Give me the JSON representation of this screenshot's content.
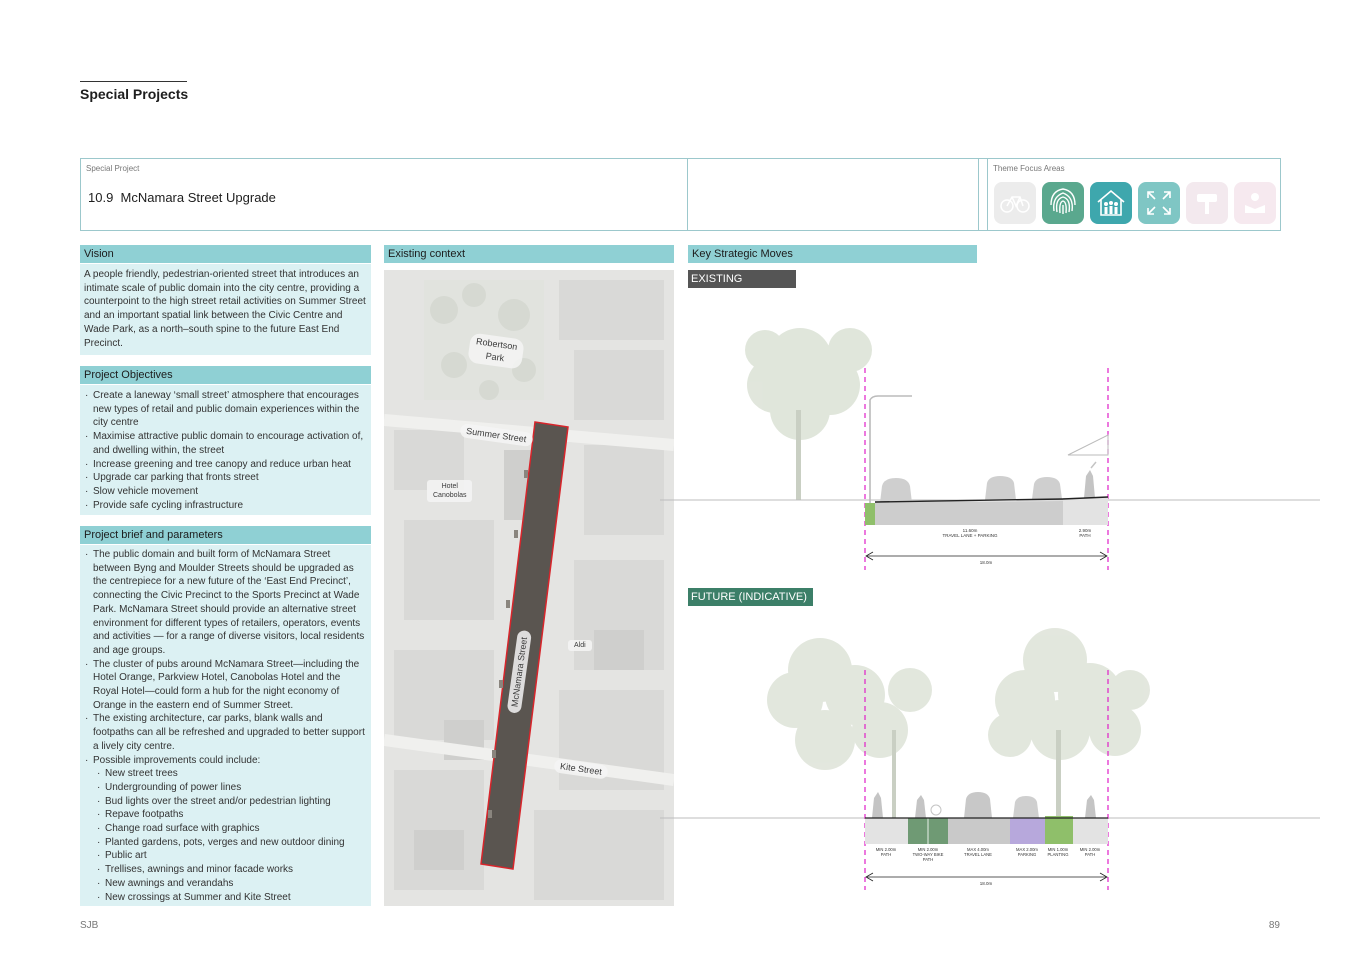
{
  "header": {
    "section_title": "Special Projects"
  },
  "project": {
    "label": "Special Project",
    "number": "10.9",
    "title": "McNamara Street Upgrade",
    "themes_label": "Theme Focus Areas",
    "theme_icons": [
      {
        "icon": "bicycle-icon",
        "active": false,
        "color": "#e6e6e6"
      },
      {
        "icon": "fingerprint-icon",
        "active": true,
        "color": "#5aa88e"
      },
      {
        "icon": "community-house-icon",
        "active": true,
        "color": "#3ea7ad"
      },
      {
        "icon": "expand-arrows-icon",
        "active": true,
        "color": "#7fc6c4"
      },
      {
        "icon": "heritage-icon",
        "active": false,
        "color": "#f3e9ee"
      },
      {
        "icon": "learning-icon",
        "active": false,
        "color": "#f6e9ef"
      }
    ]
  },
  "vision": {
    "heading": "Vision",
    "text": "A people friendly, pedestrian-oriented street that introduces an intimate scale of public domain into the city centre, providing a counterpoint to the high street retail activities on Summer Street and an important spatial link between the Civic Centre and Wade Park, as a north–south spine to the future East End Precinct."
  },
  "objectives": {
    "heading": "Project Objectives",
    "items": [
      "Create a laneway ‘small street’ atmosphere that encourages new types of retail and public domain experiences within the city centre",
      "Maximise attractive public domain to encourage activation of, and dwelling within, the street",
      "Increase greening and tree canopy and reduce urban heat",
      "Upgrade car parking that fronts street",
      "Slow vehicle movement",
      "Provide safe cycling infrastructure"
    ]
  },
  "brief": {
    "heading": "Project brief and parameters",
    "items": [
      "The public domain and built form of McNamara Street between Byng and Moulder Streets should be upgraded as the centrepiece for a new future of the ‘East End Precinct’, connecting the Civic Precinct to the Sports Precinct at Wade Park. McNamara Street should provide an alternative street environment for different types of retailers, operators, events and activities — for a range of diverse visitors, local residents and age groups.",
      "The cluster of pubs around McNamara Street—including the Hotel Orange, Parkview Hotel, Canobolas Hotel and the Royal Hotel—could form a hub for the night economy of Orange in the eastern end of Summer Street.",
      "The existing architecture, car parks, blank walls and footpaths can all be refreshed and upgraded to better support a lively city centre."
    ],
    "improvements_intro": "Possible improvements could include:",
    "improvements": [
      "New street trees",
      "Undergrounding of power lines",
      "Bud lights over the street and/or pedestrian lighting",
      "Repave footpaths",
      "Change road surface with graphics",
      "Planted gardens, pots, verges and new outdoor dining",
      "Public art",
      "Trellises, awnings and minor facade works",
      "New awnings and verandahs",
      "New crossings at Summer and Kite Street"
    ]
  },
  "context": {
    "heading": "Existing context",
    "labels": {
      "robertson_park_1": "Robertson",
      "robertson_park_2": "Park",
      "summer_street": "Summer Street",
      "hotel_1": "Hotel",
      "hotel_2": "Canobolas",
      "aldi": "Aldi",
      "mcnamara_street": "McNamara Street",
      "kite_street": "Kite Street"
    },
    "highlight_color": "#d8252b"
  },
  "moves": {
    "heading": "Key Strategic Moves",
    "existing_label": "EXISTING",
    "future_label": "FUTURE (INDICATIVE)",
    "existing_dims": {
      "lane_1": "11.60m",
      "lane_2": "TRAVEL LANE + PARKING",
      "path_1": "2.90m",
      "path_2": "PATH",
      "total": "18.0m"
    },
    "future_dims": {
      "p1a": "MIN 2.00m",
      "p1b": "PATH",
      "b1a": "MIN 2.00m",
      "b1b": "TWO-WAY BIKE",
      "b1c": "PATH",
      "t1a": "MAX 4.00m",
      "t1b": "TRAVEL LANE",
      "k1a": "MAX 2.00m",
      "k1b": "PARKING",
      "g1a": "MIN 1.00m",
      "g1b": "PLANTING",
      "p2a": "MIN 2.00m",
      "p2b": "PATH",
      "total": "18.0m"
    },
    "colors": {
      "guide": "#e020c8",
      "bike": "#6f9a74",
      "parking": "#b7a8dc",
      "planting": "#8fbf6a",
      "road": "#c9c9c9",
      "path": "#e3e3e3"
    }
  },
  "footer": {
    "left": "SJB",
    "page": "89"
  }
}
